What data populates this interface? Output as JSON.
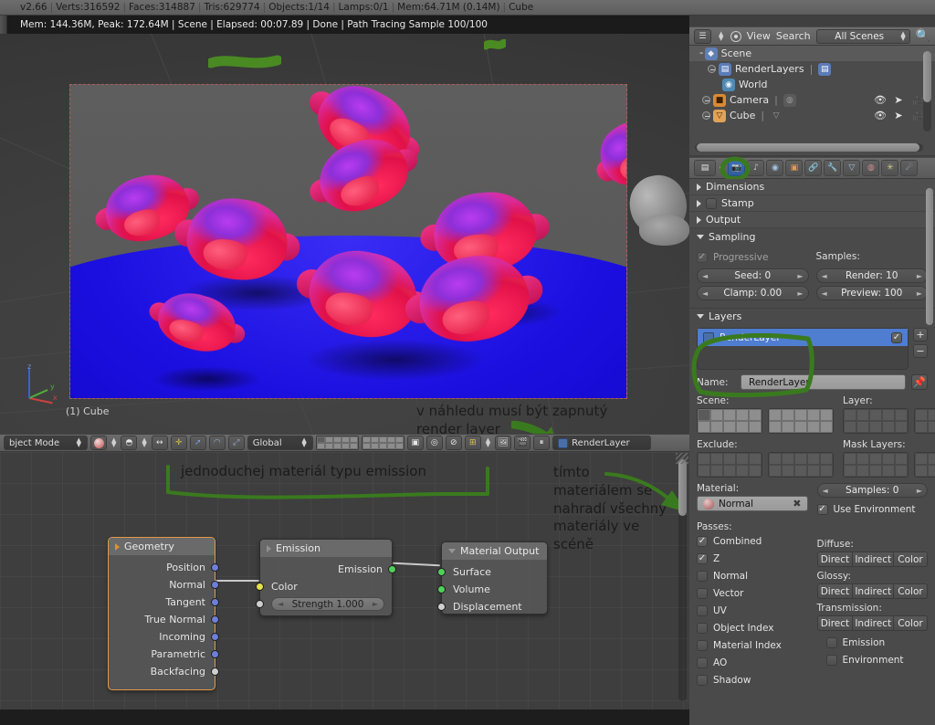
{
  "topbar": {
    "version": "v2.66",
    "verts": "Verts:316592",
    "faces": "Faces:314887",
    "tris": "Tris:629774",
    "objects": "Objects:1/14",
    "lamps": "Lamps:0/1",
    "mem": "Mem:64.71M (0.14M)",
    "active_object": "Cube",
    "sep": "|"
  },
  "viewport": {
    "render_info": "Mem: 144.36M, Peak: 172.64M | Scene | Elapsed: 00:07.89 | Done | Path Tracing Sample 100/100",
    "object_label": "(1) Cube",
    "axis": {
      "x": "x",
      "y": "y",
      "z": "z"
    },
    "annotation_1": "v náhledu musí být zapnutý\nrender layer"
  },
  "viewport_footer": {
    "mode": "bject Mode",
    "transform_orientation": "Global",
    "renderlayer_label": "RenderLayer",
    "icons": [
      "editmode-toggle-icon",
      "shading-mode-icon",
      "viewport-shading-icon",
      "proportional-edit-icon",
      "manipulator-translate-icon",
      "manipulator-rotate-icon",
      "manipulator-scale-icon",
      "snap-magnet-icon",
      "snap-element-icon",
      "render-image-icon",
      "render-animation-icon",
      "pause-icon",
      "renderlayer-icon"
    ]
  },
  "node_editor": {
    "annotation_left": "jednoduchej materiál typu emission",
    "annotation_right": "tímto\nmateriálem se\nnahradí všechny\nmateriály ve\nscéně",
    "nodes": [
      {
        "title": "Geometry",
        "selected": true,
        "outputs": [
          {
            "label": "Position",
            "color": "#6f7fd8"
          },
          {
            "label": "Normal",
            "color": "#6f7fd8"
          },
          {
            "label": "Tangent",
            "color": "#6f7fd8"
          },
          {
            "label": "True Normal",
            "color": "#6f7fd8"
          },
          {
            "label": "Incoming",
            "color": "#6f7fd8"
          },
          {
            "label": "Parametric",
            "color": "#6f7fd8"
          },
          {
            "label": "Backfacing",
            "color": "#cfcfcf"
          }
        ]
      },
      {
        "title": "Emission",
        "selected": false,
        "outputs": [
          {
            "label": "Emission",
            "color": "#4fd05a"
          }
        ],
        "inputs": [
          {
            "label": "Color",
            "color": "#e5e14a"
          },
          {
            "label": "Strength 1.000",
            "color": "#cfcfcf",
            "is_value": true
          }
        ]
      },
      {
        "title": "Material Output",
        "selected": false,
        "inputs": [
          {
            "label": "Surface",
            "color": "#4fd05a"
          },
          {
            "label": "Volume",
            "color": "#4fd05a"
          },
          {
            "label": "Displacement",
            "color": "#cfcfcf"
          }
        ]
      }
    ]
  },
  "outliner": {
    "header": {
      "display_mode_icon": "outliner-display-mode-icon",
      "filter_icon": "filter-circle-icon",
      "view_menu": "View",
      "search_menu": "Search",
      "scope": "All Scenes",
      "search_icon": "search-icon"
    },
    "rows": [
      {
        "label": "Scene",
        "indent": 0,
        "icon": "scene-icon",
        "selected": true,
        "expander": false,
        "extra": ""
      },
      {
        "label": "RenderLayers",
        "indent": 1,
        "icon": "renderlayers-icon",
        "selected": false,
        "expander": true,
        "extra": "renderlayer-icon"
      },
      {
        "label": "World",
        "indent": 1,
        "icon": "world-icon",
        "selected": false,
        "expander": false,
        "extra": ""
      },
      {
        "label": "Camera",
        "indent": 1,
        "icon": "camera-icon",
        "selected": false,
        "expander": true,
        "extra": "camera-data-icon"
      },
      {
        "label": "Cube",
        "indent": 1,
        "icon": "mesh-icon",
        "selected": false,
        "expander": true,
        "extra": "mesh-data-icon"
      }
    ]
  },
  "properties": {
    "tabs": [
      "render-tab-icon",
      "render-layers-tab-icon",
      "scene-tab-icon",
      "world-tab-icon",
      "object-tab-icon",
      "constraints-tab-icon",
      "modifiers-tab-icon",
      "data-tab-icon",
      "material-tab-icon",
      "particles-tab-icon",
      "physics-tab-icon"
    ],
    "active_tab_index": 1,
    "panels": [
      {
        "title": "Dimensions",
        "open": false
      },
      {
        "title": "Stamp",
        "open": false
      },
      {
        "title": "Output",
        "open": false
      },
      {
        "title": "Sampling",
        "open": true
      },
      {
        "title": "Layers",
        "open": true
      }
    ],
    "sampling": {
      "progressive_label": "Progressive",
      "progressive_checked": true,
      "samples_label": "Samples:",
      "seed": "Seed: 0",
      "clamp": "Clamp: 0.00",
      "render": "Render: 10",
      "preview": "Preview: 100"
    },
    "layers": {
      "list_item": "RenderLayer",
      "list_item_enabled": true,
      "add_label": "+",
      "remove_label": "−",
      "name_label": "Name:",
      "name_value": "RenderLayer",
      "pin_icon": "pin-icon",
      "scene_label": "Scene:",
      "layer_label": "Layer:",
      "exclude_label": "Exclude:",
      "mask_layers_label": "Mask Layers:",
      "material_label": "Material:",
      "material_value": "Normal",
      "material_clear_icon": "x-icon",
      "samples": "Samples: 0",
      "use_environment_label": "Use Environment",
      "use_environment_checked": true,
      "passes_label": "Passes:",
      "passes_left": [
        {
          "label": "Combined",
          "checked": true
        },
        {
          "label": "Z",
          "checked": true
        },
        {
          "label": "Normal",
          "checked": false
        },
        {
          "label": "Vector",
          "checked": false
        },
        {
          "label": "UV",
          "checked": false
        },
        {
          "label": "Object Index",
          "checked": false
        },
        {
          "label": "Material Index",
          "checked": false
        },
        {
          "label": "AO",
          "checked": false
        },
        {
          "label": "Shadow",
          "checked": false
        }
      ],
      "pass_groups": [
        {
          "label": "Diffuse:",
          "buttons": [
            "Direct",
            "Indirect",
            "Color"
          ]
        },
        {
          "label": "Glossy:",
          "buttons": [
            "Direct",
            "Indirect",
            "Color"
          ]
        },
        {
          "label": "Transmission:",
          "buttons": [
            "Direct",
            "Indirect",
            "Color"
          ]
        }
      ],
      "extra_passes": [
        {
          "label": "Emission",
          "checked": false
        },
        {
          "label": "Environment",
          "checked": false
        }
      ]
    }
  },
  "colors": {
    "accent_blue": "#4f7dd0",
    "annotation_green": "#3a7a1e",
    "node_socket_shader": "#4fd05a",
    "node_socket_vector": "#6f7fd8",
    "node_socket_color": "#e5e14a",
    "render_border": "#b25a5a"
  }
}
